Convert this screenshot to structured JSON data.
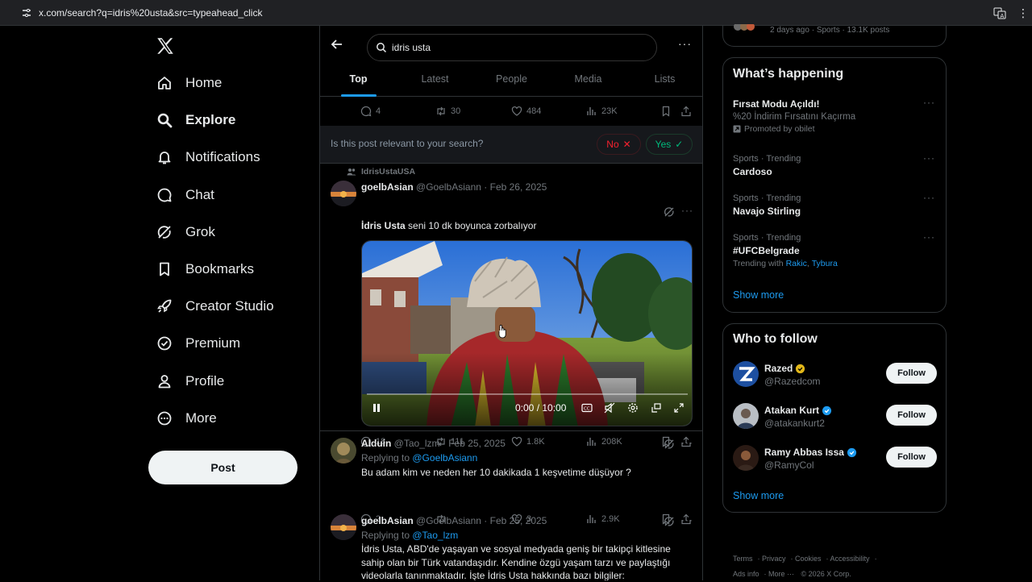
{
  "browser": {
    "url": "x.com/search?q=idris%20usta&src=typeahead_click"
  },
  "nav": {
    "items": [
      {
        "label": "Home",
        "icon": "home-icon"
      },
      {
        "label": "Explore",
        "icon": "search-icon"
      },
      {
        "label": "Notifications",
        "icon": "bell-icon"
      },
      {
        "label": "Chat",
        "icon": "chat-icon"
      },
      {
        "label": "Grok",
        "icon": "grok-icon"
      },
      {
        "label": "Bookmarks",
        "icon": "bookmark-icon"
      },
      {
        "label": "Creator Studio",
        "icon": "rocket-icon"
      },
      {
        "label": "Premium",
        "icon": "verified-icon"
      },
      {
        "label": "Profile",
        "icon": "person-icon"
      },
      {
        "label": "More",
        "icon": "more-circle-icon"
      }
    ],
    "post_label": "Post"
  },
  "search": {
    "value": "idris usta"
  },
  "tabs": [
    "Top",
    "Latest",
    "People",
    "Media",
    "Lists"
  ],
  "first_post_stats": {
    "replies": "4",
    "reposts": "30",
    "likes": "484",
    "views": "23K"
  },
  "relevance": {
    "question": "Is this post relevant to your search?",
    "no_label": "No",
    "yes_label": "Yes"
  },
  "posts": [
    {
      "context": "IdrisUstaUSA",
      "name": "goelbAsian",
      "handle": "@GoelbAsiann",
      "date": "· Feb 26, 2025",
      "text_bold": "İdris Usta",
      "text": " seni 10 dk boyunca zorbalıyor",
      "video_time": "0:00 / 10:00",
      "stats": {
        "replies": "18",
        "reposts": "111",
        "likes": "1.8K",
        "views": "208K"
      }
    },
    {
      "name": "Alduin",
      "handle": "@Tao_lzm",
      "date": "· Feb 25, 2025",
      "replying_prefix": "Replying to ",
      "replying_to": "@GoelbAsiann",
      "text": "Bu adam kim ve neden her 10 dakikada 1 keşvetime düşüyor ?",
      "stats": {
        "replies": "2",
        "reposts": "",
        "likes": "3",
        "views": "2.9K"
      }
    },
    {
      "name": "goelbAsian",
      "handle": "@GoelbAsiann",
      "date": "· Feb 25, 2025",
      "replying_prefix": "Replying to ",
      "replying_to": "@Tao_lzm",
      "text": "İdris Usta, ABD'de yaşayan ve sosyal medyada geniş bir takipçi kitlesine sahip olan bir Türk vatandaşıdır. Kendine özgü yaşam tarzı ve paylaştığı videolarla tanınmaktadır. İşte İdris Usta hakkında bazı bilgiler:"
    }
  ],
  "top_cut": {
    "text": "2 days ago · Sports · 13.1K posts"
  },
  "whats_happening": {
    "title": "What’s happening",
    "trends": [
      {
        "context": "",
        "title": "Fırsat Modu Açıldı!",
        "subtitle": "%20 İndirim Fırsatını Kaçırma",
        "promoted": "Promoted by obilet"
      },
      {
        "context": "Sports · Trending",
        "title": "Cardoso"
      },
      {
        "context": "Sports · Trending",
        "title": "Navajo Stirling"
      },
      {
        "context": "Sports · Trending",
        "title": "#UFCBelgrade",
        "trending_with_prefix": "Trending with ",
        "trending_with_1": "Rakic",
        "trending_with_sep": ", ",
        "trending_with_2": "Tybura"
      }
    ],
    "show_more": "Show more"
  },
  "who_to_follow": {
    "title": "Who to follow",
    "accounts": [
      {
        "name": "Razed",
        "handle": "@Razedcom",
        "badge_color": "#e2b719"
      },
      {
        "name": "Atakan Kurt",
        "handle": "@atakankurt2",
        "badge_color": "#1d9bf0"
      },
      {
        "name": "Ramy Abbas Issa",
        "handle": "@RamyCol",
        "badge_color": "#1d9bf0"
      }
    ],
    "follow_label": "Follow",
    "show_more": "Show more"
  },
  "footer": {
    "links": [
      "Terms",
      "Privacy",
      "Cookies",
      "Accessibility",
      "Ads info",
      "More ···",
      "© 2026 X Corp."
    ]
  },
  "colors": {
    "accent": "#1d9bf0",
    "background": "#000000",
    "no": "#f4212e",
    "yes": "#00ba7c"
  }
}
